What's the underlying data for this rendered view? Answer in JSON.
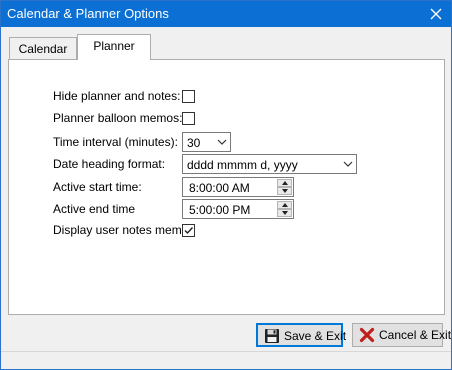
{
  "window": {
    "title": "Calendar & Planner Options"
  },
  "tabs": [
    {
      "label": "Calendar",
      "active": false
    },
    {
      "label": "Planner",
      "active": true
    }
  ],
  "form": {
    "hide_planner": {
      "label": "Hide planner and notes:",
      "checked": false
    },
    "balloon_memos": {
      "label": "Planner balloon memos:",
      "checked": false
    },
    "time_interval": {
      "label": "Time interval  (minutes):",
      "value": "30"
    },
    "date_heading": {
      "label": "Date heading format:",
      "value": "dddd mmmm d, yyyy"
    },
    "active_start": {
      "label": "Active start time:",
      "value": "8:00:00 AM"
    },
    "active_end": {
      "label": "Active end time",
      "value": "5:00:00 PM"
    },
    "user_notes": {
      "label": "Display user notes memo:",
      "checked": true
    }
  },
  "buttons": {
    "save": "Save & Exit",
    "cancel": "Cancel & Exit"
  },
  "icons": {
    "close": "close-icon",
    "save": "floppy-disk-icon",
    "cancel": "red-x-icon"
  },
  "colors": {
    "titlebar": "#0b6fd4",
    "accent": "#0078d7",
    "cancel_icon": "#c0201b"
  }
}
